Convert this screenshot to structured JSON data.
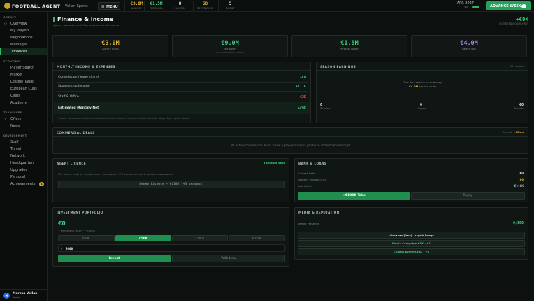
{
  "topbar": {
    "brand": "FOOTBALL AGENT",
    "agency": "Vellan Sports",
    "menu_label": "MENU",
    "menu_icon": "☰",
    "stats": [
      {
        "value": "€9.0M",
        "label": "AGENCY",
        "color": "#e0b43a"
      },
      {
        "value": "€1.5M",
        "label": "PERSONAL",
        "color": "#3ccf7e"
      },
      {
        "value": "8",
        "label": "PLAYERS",
        "color": "#e6ece8"
      },
      {
        "value": "58",
        "label": "REPUTATION",
        "color": "#e0b43a"
      },
      {
        "value": "5",
        "label": "SCOUT",
        "color": "#e6ece8"
      }
    ],
    "date": "APR 2027",
    "week": "W4",
    "advance_label": "ADVANCE WEEK",
    "status_dots": "●●●"
  },
  "sidebar": {
    "sections": [
      {
        "title": "AGENCY",
        "items": [
          {
            "label": "Overview",
            "icon": "◇",
            "active": false
          },
          {
            "label": "My Players",
            "icon": "",
            "active": false
          },
          {
            "label": "Negotiations",
            "icon": "",
            "active": false
          },
          {
            "label": "Messages",
            "icon": "",
            "active": false
          },
          {
            "label": "Finances",
            "icon": "",
            "active": true
          }
        ]
      },
      {
        "title": "SCOUTING",
        "items": [
          {
            "label": "Player Search",
            "icon": "",
            "active": false
          },
          {
            "label": "Market",
            "icon": "",
            "active": false
          },
          {
            "label": "League Table",
            "icon": "",
            "active": false
          },
          {
            "label": "European Cups",
            "icon": "",
            "active": false
          },
          {
            "label": "Clubs",
            "icon": "",
            "active": false
          },
          {
            "label": "Academy",
            "icon": "",
            "active": false
          }
        ]
      },
      {
        "title": "TRANSFERS",
        "items": [
          {
            "label": "Offers",
            "icon": "✓",
            "active": false
          },
          {
            "label": "News",
            "icon": "",
            "active": false
          }
        ]
      },
      {
        "title": "DEVELOPMENT",
        "items": [
          {
            "label": "Staff",
            "icon": "",
            "active": false
          },
          {
            "label": "Travel",
            "icon": "",
            "active": false
          },
          {
            "label": "Network",
            "icon": "",
            "active": false
          },
          {
            "label": "Headquarters",
            "icon": "",
            "active": false
          },
          {
            "label": "Upgrades",
            "icon": "",
            "active": false
          },
          {
            "label": "Personal",
            "icon": "",
            "active": false
          },
          {
            "label": "Achievements",
            "icon": "",
            "active": false,
            "badge": "4"
          }
        ]
      }
    ],
    "user": {
      "initials": "M",
      "name": "Marcus Vellan",
      "role": "Agent"
    }
  },
  "header": {
    "title": "Finance & Income",
    "subtitle": "Agency accounts, cash flow and commercial income",
    "net_value": "+€9K",
    "net_label": "ESTIMATED MONTHLY NET"
  },
  "cards": [
    {
      "value": "€9.0M",
      "label": "Agency Funds",
      "sub": "",
      "color": "#e0b43a"
    },
    {
      "value": "€9.0M",
      "label": "Net Worth",
      "sub": "incl. investments & assets",
      "color": "#3ccf7e"
    },
    {
      "value": "€1.5M",
      "label": "Personal Wealth",
      "sub": "",
      "color": "#3ccf7e"
    },
    {
      "value": "€4.0M",
      "label": "Career Total",
      "sub": "",
      "color": "#a98be6"
    }
  ],
  "monthly": {
    "title": "MONTHLY INCOME & EXPENSES",
    "rows": [
      {
        "label": "Commission (wage share)",
        "value": "+€0",
        "color": "#3ccf7e"
      },
      {
        "label": "Sponsorship Income",
        "value": "+€11K",
        "color": "#3ccf7e"
      },
      {
        "label": "Staff & Office",
        "value": "-€2K",
        "color": "#e0554f"
      }
    ],
    "net_label": "Estimated Monthly Net",
    "net_value": "+€9K",
    "note": "Transfer commissions, bonus fees and sell-on percentages are paid when deals complete. Wage share is paid monthly."
  },
  "season": {
    "title": "SEASON EARNINGS",
    "right": "This season",
    "msg1": "This first season is underway.",
    "msg2_value": "€4.0M",
    "msg2_rest": " earned so far",
    "stats": [
      {
        "value": "0",
        "label": "Transfers"
      },
      {
        "value": "0",
        "label": "Players"
      },
      {
        "value": "€0",
        "label": "Bonuses"
      }
    ]
  },
  "commercial": {
    "title": "COMMERCIAL DEALS",
    "right_label": "Current: ",
    "right_value": "+€0/mo",
    "empty": "No active commercial deals. Grow a player's media profile to attract sponsorships."
  },
  "licence": {
    "title": "AGENT LICENCE",
    "status": "3 seasons valid",
    "note": "The licence must be renewed every few seasons. If it expires you can't represent new players.",
    "button": "Renew Licence — €110K (+3 seasons)"
  },
  "bank": {
    "title": "BANK & LOANS",
    "rows": [
      {
        "label": "Current Debt",
        "value": "€0",
        "color": "#e6ece8"
      },
      {
        "label": "Monthly Interest (5%)",
        "value": "€0",
        "color": "#e0b43a"
      },
      {
        "label": "Loan Limit",
        "value": "€448K",
        "color": "#b7c1bc"
      }
    ],
    "take": "+€100K Take",
    "repay": "Repay"
  },
  "investment": {
    "title": "INVESTMENT PORTFOLIO",
    "value": "€0",
    "sub": "+ €0 monthly return · ~9%/mo",
    "options": [
      "€20K",
      "€50K",
      "€100K",
      "€250K"
    ],
    "selected": 1,
    "amount_prefix": "€",
    "amount": "5000",
    "invest": "Invest",
    "withdraw": "Withdraw"
  },
  "media": {
    "title": "MEDIA & REPUTATION",
    "label": "Media Presence",
    "value": "0/100",
    "actions": [
      {
        "label": "Interview (free) · repair image",
        "color": "#e6ece8"
      },
      {
        "label": "Media Campaign €5K · +1",
        "color": "#3ccf7e"
      },
      {
        "label": "Charity Event €10K · +4",
        "color": "#3ccf7e"
      }
    ]
  }
}
